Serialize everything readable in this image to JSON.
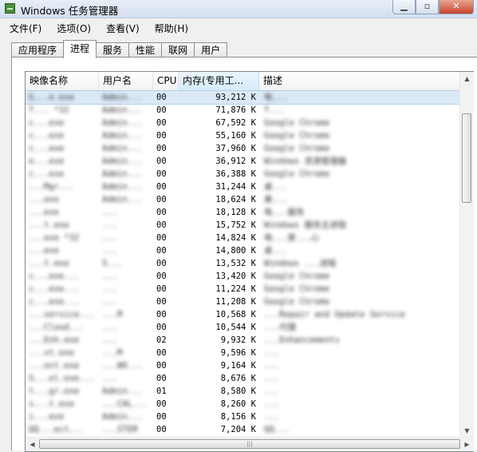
{
  "window": {
    "title": "Windows 任务管理器"
  },
  "menu": [
    "文件(F)",
    "选项(O)",
    "查看(V)",
    "帮助(H)"
  ],
  "tabs": [
    {
      "label": "应用程序",
      "active": false
    },
    {
      "label": "进程",
      "active": true
    },
    {
      "label": "服务",
      "active": false
    },
    {
      "label": "性能",
      "active": false
    },
    {
      "label": "联网",
      "active": false
    },
    {
      "label": "用户",
      "active": false
    }
  ],
  "columns": [
    "映像名称",
    "用户名",
    "CPU",
    "内存(专用工...",
    "描述"
  ],
  "rows": [
    [
      "G...e.exe",
      "Admin...",
      "00",
      "93,212 K",
      "电..."
    ],
    [
      "T... *32",
      "Admin...",
      "00",
      "71,876 K",
      "T..."
    ],
    [
      "c...exe",
      "Admin...",
      "00",
      "67,592 K",
      "Google Chrome"
    ],
    [
      "c...exe",
      "Admin...",
      "00",
      "55,160 K",
      "Google Chrome"
    ],
    [
      "c...exe",
      "Admin...",
      "00",
      "37,960 K",
      "Google Chrome"
    ],
    [
      "e...exe",
      "Admin...",
      "00",
      "36,912 K",
      "Windows 资源管理器"
    ],
    [
      "c...exe",
      "Admin...",
      "00",
      "36,388 K",
      "Google Chrome"
    ],
    [
      "...Mgr...",
      "Admin...",
      "00",
      "31,244 K",
      "桌..."
    ],
    [
      "...exe",
      "Admin...",
      "00",
      "18,624 K",
      "美..."
    ],
    [
      "...exe",
      "...",
      "00",
      "18,128 K",
      "电...服务"
    ],
    [
      "...t.exe",
      "...",
      "00",
      "15,752 K",
      "Windows 服务主进程"
    ],
    [
      "...exe *32",
      "...",
      "00",
      "14,824 K",
      "电...家...心"
    ],
    [
      "...exe",
      "...",
      "00",
      "14,800 K",
      "桌..."
    ],
    [
      "...t.exe",
      "S...",
      "00",
      "13,532 K",
      "Windows ...进程"
    ],
    [
      "c...exe...",
      "...",
      "00",
      "13,420 K",
      "Google Chrome"
    ],
    [
      "c...exe...",
      "...",
      "00",
      "11,224 K",
      "Google Chrome"
    ],
    [
      "c...exe...",
      "...",
      "00",
      "11,208 K",
      "Google Chrome"
    ],
    [
      "...service...",
      "...M",
      "00",
      "10,568 K",
      "...Repair and Update Service"
    ],
    [
      "...Cloud...",
      "...",
      "00",
      "10,544 K",
      "...代理"
    ],
    [
      "...Enh.exe",
      "...",
      "02",
      "9,932 K",
      "...Enhancements"
    ],
    [
      "...st.exe",
      "...M",
      "00",
      "9,596 K",
      "..."
    ],
    [
      "...ost.exe",
      "...WO...",
      "00",
      "9,164 K",
      "..."
    ],
    [
      "S...ol.exe...",
      "...",
      "00",
      "8,676 K",
      "..."
    ],
    [
      "t...gr.exe",
      "Admin...",
      "01",
      "8,580 K",
      "..."
    ],
    [
      "s...t.exe",
      "...CAL...",
      "00",
      "8,260 K",
      "..."
    ],
    [
      "i...exe",
      "Admin...",
      "00",
      "8,156 K",
      "..."
    ],
    [
      "QQ...ect...",
      "...STEM",
      "00",
      "7,204 K",
      "QQ..."
    ]
  ]
}
